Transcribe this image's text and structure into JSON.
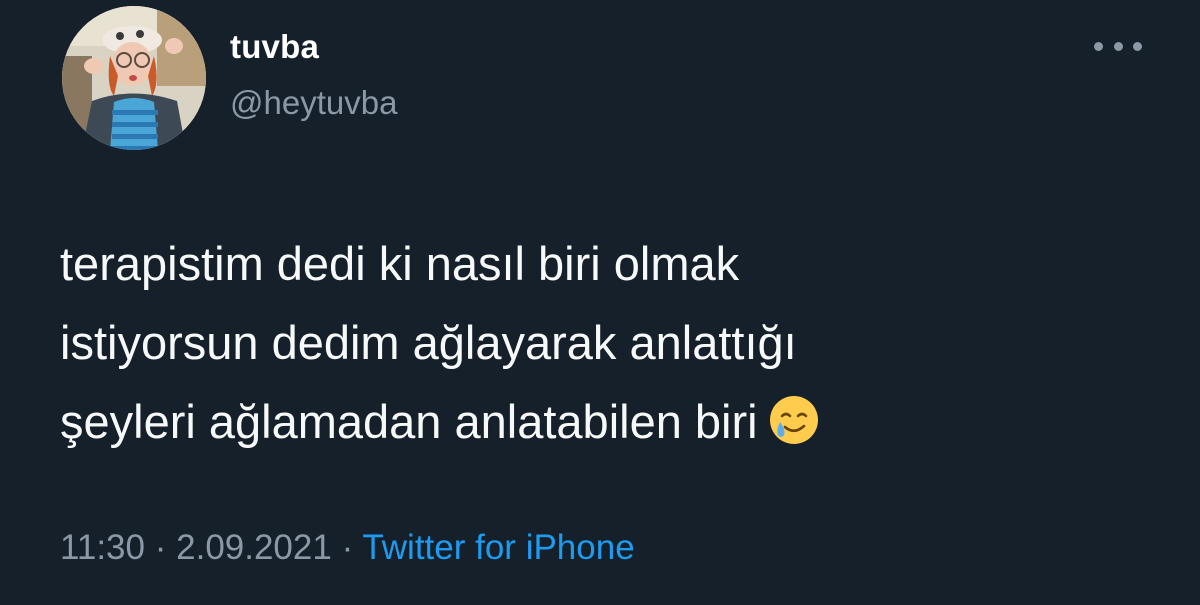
{
  "user": {
    "display_name": "tuvba",
    "handle": "@heytuvba"
  },
  "more_icon": "more-horizontal-icon",
  "tweet": {
    "lines": [
      "terapistim dedi ki nasıl biri olmak",
      "istiyorsun dedim ağlayarak anlattığı",
      "şeyleri ağlamadan anlatabilen biri"
    ],
    "emoji": "smiling-face-with-tear-icon"
  },
  "meta": {
    "time": "11:30",
    "separator": "·",
    "date": "2.09.2021",
    "source": "Twitter for iPhone"
  },
  "colors": {
    "background": "#15202b",
    "text": "#f7f9f9",
    "secondary": "#8b98a5",
    "link": "#1d9bf0"
  }
}
